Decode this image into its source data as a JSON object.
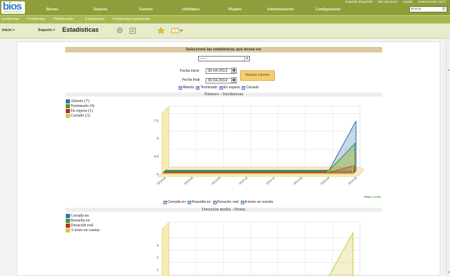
{
  "header": {
    "logo": "bios",
    "logo_sub": "technology solutions",
    "user_links": [
      "Español (Español)",
      "Mis opciones",
      "Ayuda",
      "Desconexión (317)"
    ],
    "menu": [
      "Bienes",
      "Soporte",
      "Gestión",
      "Utilidades",
      "Plugins",
      "Administración",
      "Configuración"
    ],
    "search_value": "Buscar"
  },
  "submenu": [
    "Incidencias",
    "Problemas",
    "Planificación",
    "Estadísticas",
    "Incidencias recurrentes"
  ],
  "breadcrumb": {
    "items": [
      "Inicio >",
      "Soporte >"
    ],
    "title": "Estadísticas"
  },
  "stats": {
    "select_header": "Seleccione las estadísticas que desea ver",
    "select_value": "-----",
    "start_label": "Fecha inicio",
    "start_value": "30-04-2013",
    "end_label": "Fecha final",
    "end_value": "30-04-2014",
    "show_button": "Mostrar informe",
    "status_checks": [
      "Abierto",
      "Terminado",
      "En espera",
      "Cerrado"
    ],
    "duration_checks": [
      "Cerrada en",
      "Resuelta en",
      "Duración real",
      "A tener en cuenta"
    ],
    "export": "PNG / CSV"
  },
  "colors": {
    "header": "#8f9e3a",
    "submenu": "#a9b752",
    "open": "#3a6fb5",
    "done": "#3d9a2a",
    "waiting": "#c0281c",
    "closed": "#d8c44a"
  },
  "chart_data": [
    {
      "type": "area",
      "title": "Número - Incidencias",
      "series": [
        {
          "name": "Abierto (7)",
          "values": [
            0,
            0,
            0,
            0,
            0,
            0,
            0,
            7
          ]
        },
        {
          "name": "Terminado (4)",
          "values": [
            0,
            0,
            0,
            0,
            0,
            0,
            0,
            4
          ]
        },
        {
          "name": "En espera (1)",
          "values": [
            0,
            0,
            0,
            0,
            0,
            0,
            0,
            1
          ]
        },
        {
          "name": "Cerrado (3)",
          "values": [
            0,
            0,
            0,
            0,
            0,
            0,
            0,
            3
          ]
        }
      ],
      "categories": [
        "2013-04",
        "2013-06",
        "2013-08",
        "2013-10",
        "2013-12",
        "2014-02",
        "2014-04",
        "2014-05"
      ],
      "yticks": [
        "0",
        "2.5",
        "5",
        "7.5"
      ],
      "ylim": [
        0,
        8.5
      ],
      "grid": true
    },
    {
      "type": "area",
      "title": "Duración media - Horas",
      "series": [
        {
          "name": "Cerrada en",
          "values": [
            0,
            0,
            0,
            0,
            0,
            0,
            0,
            0
          ]
        },
        {
          "name": "Resuelta en",
          "values": [
            0,
            0,
            0,
            0,
            0,
            0,
            0,
            0
          ]
        },
        {
          "name": "Duración real",
          "values": [
            0,
            0,
            0,
            0,
            0,
            0,
            0,
            0
          ]
        },
        {
          "name": "A tener en cuenta",
          "values": [
            0,
            0,
            0,
            0,
            0,
            0,
            0,
            4
          ]
        }
      ],
      "yticks": [
        "1",
        "2",
        "3"
      ],
      "ylim": [
        0,
        4.3
      ],
      "grid": true
    }
  ]
}
